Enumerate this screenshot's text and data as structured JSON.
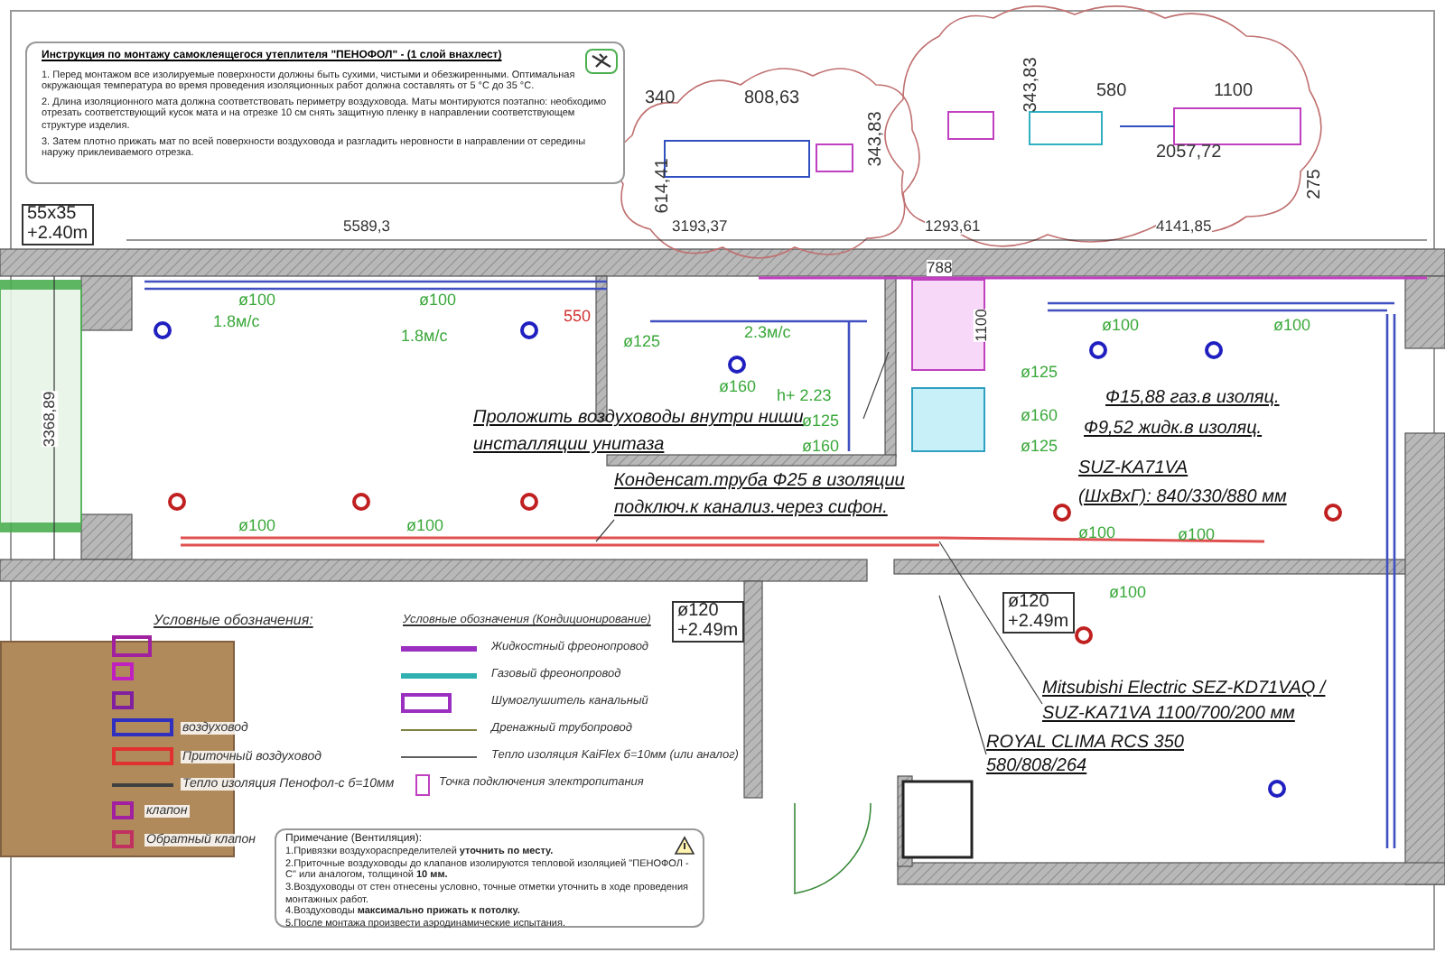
{
  "instructions": {
    "title": "Инструкция по монтажу самоклеящегося утеплителя \"ПЕНОФОЛ\" - (1 слой внахлест)",
    "items": [
      "1. Перед монтажом все изолируемые поверхности должны быть сухими, чистыми и обезжиренными. Оптимальная окружающая температура во время проведения изоляционных работ должна составлять от 5 °С до 35 °С.",
      "2. Длина изоляционного мата должна соответствовать периметру воздуховода. Маты монтируются поэтапно: необходимо отрезать соответствующий кусок мата и на отрезке 10 см снять защитную пленку в направлении соответствующем структуре изделия.",
      "3. Затем плотно прижать мат по всей поверхности воздуховода и разгладить неровности в направлении от середины наружу приклеиваемого отрезка."
    ]
  },
  "detail_dimensions": [
    "340",
    "808,63",
    "343,83",
    "614,41",
    "343,83",
    "580",
    "1100",
    "2057,72",
    "275"
  ],
  "plan": {
    "labels": [
      {
        "kind": "elevation",
        "lines": [
          "55x35",
          "+2.40m"
        ]
      },
      {
        "kind": "dimension",
        "text": "5589,3"
      },
      {
        "kind": "dimension",
        "text": "3193,37"
      },
      {
        "kind": "dimension",
        "text": "1293,61"
      },
      {
        "kind": "dimension",
        "text": "4141,85"
      },
      {
        "kind": "dimension",
        "text": "3368,89"
      },
      {
        "kind": "diameter",
        "text": "ø100"
      },
      {
        "kind": "diameter",
        "text": "1.8м/с"
      },
      {
        "kind": "diameter",
        "text": "ø100"
      },
      {
        "kind": "diameter",
        "text": "1.8м/с"
      },
      {
        "kind": "offset",
        "text": "550"
      },
      {
        "kind": "diameter",
        "text": "ø125"
      },
      {
        "kind": "diameter",
        "text": "2.3м/с"
      },
      {
        "kind": "diameter",
        "text": "ø160"
      },
      {
        "kind": "diameter",
        "text": "h+ 2.23"
      },
      {
        "kind": "diameter",
        "text": "ø125"
      },
      {
        "kind": "diameter",
        "text": "ø160"
      },
      {
        "kind": "dimension",
        "text": "788"
      },
      {
        "kind": "dimension",
        "text": "1100"
      },
      {
        "kind": "diameter",
        "text": "ø125"
      },
      {
        "kind": "diameter",
        "text": "ø160"
      },
      {
        "kind": "diameter",
        "text": "ø125"
      },
      {
        "kind": "diameter",
        "text": "ø100"
      },
      {
        "kind": "diameter",
        "text": "ø100"
      },
      {
        "kind": "note",
        "text": "Ф15,88 газ.в изоляц."
      },
      {
        "kind": "note",
        "text": "Ф9,52 жидк.в изоляц."
      },
      {
        "kind": "note",
        "text": "SUZ-KA71VA"
      },
      {
        "kind": "note",
        "text": "(ШхВхГ): 840/330/880  мм"
      },
      {
        "kind": "note",
        "text": "Проложить воздуховоды внутри ниши"
      },
      {
        "kind": "note",
        "text": "инсталляции унитаза"
      },
      {
        "kind": "note",
        "text": "Конденсат.труба Ф25 в изоляции"
      },
      {
        "kind": "note",
        "text": "подключ.к канализ.через сифон."
      },
      {
        "kind": "diameter",
        "text": "ø100"
      },
      {
        "kind": "diameter",
        "text": "ø100"
      },
      {
        "kind": "diameter",
        "text": "ø100"
      },
      {
        "kind": "diameter",
        "text": "ø100"
      },
      {
        "kind": "elevation",
        "lines": [
          "ø120",
          "+2.49m"
        ]
      },
      {
        "kind": "elevation",
        "lines": [
          "ø120",
          "+2.49m"
        ]
      },
      {
        "kind": "diameter",
        "text": "ø100"
      },
      {
        "kind": "note",
        "text": "Mitsubishi Electric SEZ-KD71VAQ /"
      },
      {
        "kind": "note",
        "text": "SUZ-KA71VA 1100/700/200 мм"
      },
      {
        "kind": "note",
        "text": "ROYAL CLIMA RCS 350"
      },
      {
        "kind": "note",
        "text": "580/808/264"
      }
    ]
  },
  "legend_ventilation": {
    "title": "Условные обозначения:",
    "items": [
      {
        "kind": "fan",
        "color": "#a020a0"
      },
      {
        "kind": "square",
        "color": "#c020c0"
      },
      {
        "kind": "square",
        "color": "#8020a0"
      },
      {
        "kind": "duct",
        "color": "#3030c0",
        "text": "воздуховод"
      },
      {
        "kind": "duct",
        "color": "#e03030",
        "text": "Приточный воздуховод"
      },
      {
        "kind": "line",
        "color": "#404040",
        "text": "Тепло изоляция Пенофол-с б=10мм"
      },
      {
        "kind": "square",
        "color": "#a020a0",
        "text": "клапон"
      },
      {
        "kind": "square",
        "color": "#c03060",
        "text": "Обратный клапон"
      }
    ]
  },
  "legend_ac": {
    "title": "Условные обозначения (Кондиционирование)",
    "items": [
      {
        "kind": "line",
        "color": "#9b30c0",
        "text": "Жидкостный фреонопровод"
      },
      {
        "kind": "line",
        "color": "#30b0b0",
        "text": "Газовый фреонопровод"
      },
      {
        "kind": "silencer",
        "color": "#9b30c0",
        "text": "Шумоглушитель канальный"
      },
      {
        "kind": "thin",
        "color": "#808040",
        "text": "Дренажный трубопровод"
      },
      {
        "kind": "thin",
        "color": "#606060",
        "text": "Тепло изоляция KaiFlex б=10мм (или аналог)"
      },
      {
        "kind": "socket",
        "color": "#c040c0",
        "text": "Точка подключения электропитания"
      }
    ]
  },
  "notes": {
    "title": "Примечание (Вентиляция):",
    "items": [
      "1.Привязки воздухораспределителей **уточнить по месту.**",
      "2.Приточные воздуховоды до клапанов изолируются тепловой изоляцией \"ПЕНОФОЛ - С\" или аналогом, толщиной **10 мм.**",
      "3.Воздуховоды от стен отнесены условно, точные отметки уточнить в ходе проведения монтажных работ.",
      "4.Воздуховоды **максимально прижать к потолку.**",
      "5.После монтажа произвести аэродинамические испытания."
    ]
  }
}
